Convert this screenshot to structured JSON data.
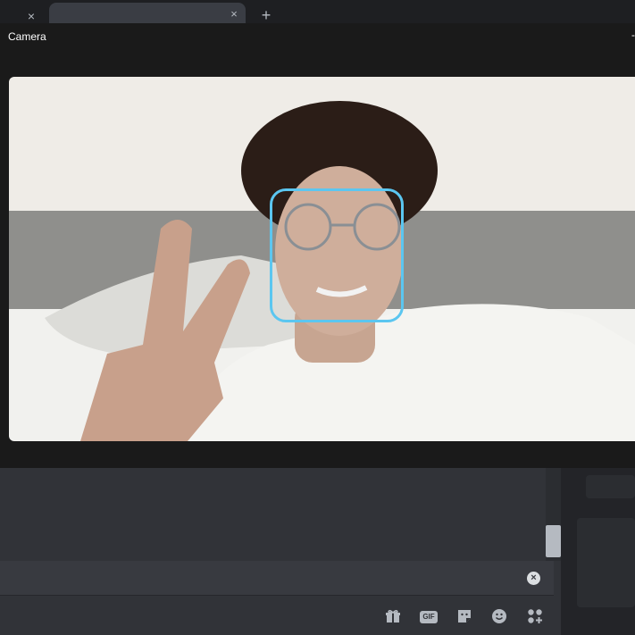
{
  "tabs": [
    {
      "close_glyph": "×"
    },
    {
      "close_glyph": "×"
    }
  ],
  "new_tab_glyph": "+",
  "camera": {
    "title": "Camera",
    "minimize_glyph": "-"
  },
  "chat_input": {
    "clear_glyph": "×"
  },
  "toolbar": {
    "gift_icon": "gift-icon",
    "gif_label": "GIF",
    "sticker_icon": "sticker-icon",
    "emoji_icon": "emoji-icon",
    "apps_icon": "apps-icon"
  },
  "colors": {
    "face_box": "#5bc6f0",
    "background": "#313338"
  }
}
